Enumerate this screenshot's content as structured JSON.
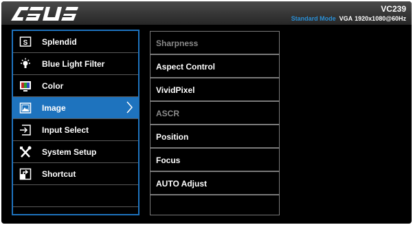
{
  "header": {
    "brand": "ASUS",
    "model": "VC239",
    "mode": "Standard Mode",
    "input": "VGA",
    "resolution": "1920x1080@60Hz"
  },
  "menu": {
    "items": [
      {
        "label": "Splendid",
        "icon": "splendid-icon"
      },
      {
        "label": "Blue Light Filter",
        "icon": "bulb-icon"
      },
      {
        "label": "Color",
        "icon": "color-icon"
      },
      {
        "label": "Image",
        "icon": "image-icon",
        "selected": true
      },
      {
        "label": "Input Select",
        "icon": "input-select-icon"
      },
      {
        "label": "System Setup",
        "icon": "tools-icon"
      },
      {
        "label": "Shortcut",
        "icon": "shortcut-icon"
      }
    ]
  },
  "submenu": {
    "items": [
      {
        "label": "Sharpness",
        "enabled": false
      },
      {
        "label": "Aspect Control",
        "enabled": true
      },
      {
        "label": "VividPixel",
        "enabled": true
      },
      {
        "label": "ASCR",
        "enabled": false
      },
      {
        "label": "Position",
        "enabled": true
      },
      {
        "label": "Focus",
        "enabled": true
      },
      {
        "label": "AUTO Adjust",
        "enabled": true
      }
    ]
  },
  "colors": {
    "accent": "#1e73be",
    "mode_text": "#2a8fd6",
    "disabled": "#8a8a8a"
  }
}
